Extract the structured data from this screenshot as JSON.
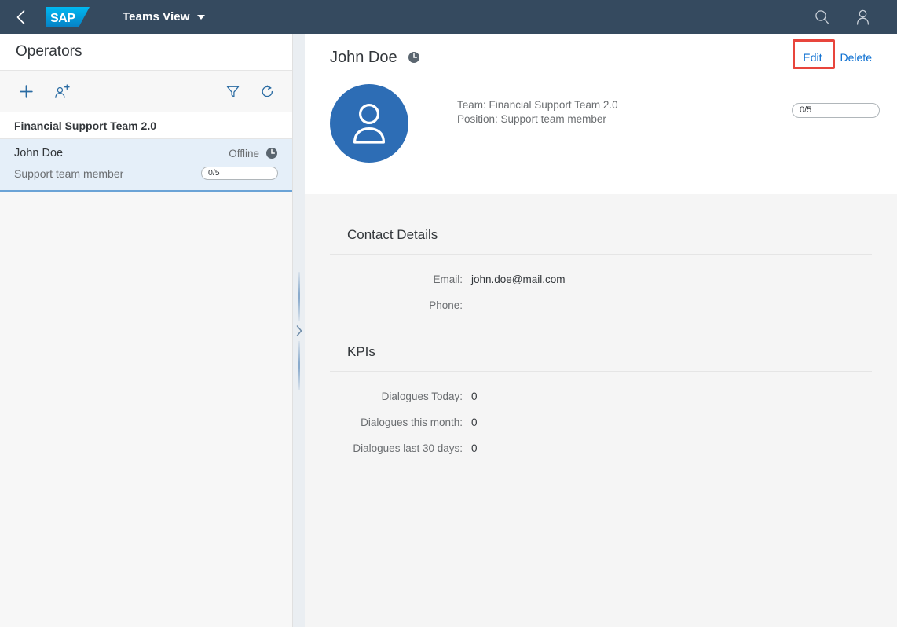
{
  "shell": {
    "back_icon": "chevron-left-icon",
    "logo_text": "SAP",
    "app_title": "Teams View",
    "dropdown_icon": "caret-down-icon",
    "search_icon": "search-icon",
    "user_icon": "user-icon",
    "header_bg": "#354a5f"
  },
  "master": {
    "title": "Operators",
    "toolbar": {
      "add_label": "add-icon",
      "add_person_label": "add-person-icon",
      "filter_label": "filter-icon",
      "refresh_label": "refresh-icon"
    },
    "group_header": "Financial Support Team 2.0",
    "items": [
      {
        "name": "John Doe",
        "status": "Offline",
        "status_icon": "clock-icon",
        "position": "Support team member",
        "progress_label": "0/5",
        "progress_percent": 0,
        "selected": true
      }
    ]
  },
  "splitter": {
    "collapse_icon": "chevron-right-icon"
  },
  "detail": {
    "title": "John Doe",
    "title_status_icon": "clock-icon",
    "actions": [
      {
        "label": "Edit",
        "highlighted": true
      },
      {
        "label": "Delete",
        "highlighted": false
      }
    ],
    "highlight_color": "#e8453c",
    "avatar_icon": "person-icon",
    "avatar_color": "#2d6db5",
    "hero": {
      "team_line": "Team: Financial Support Team 2.0",
      "position_line": "Position: Support team member",
      "progress_label": "0/5",
      "progress_percent": 0
    },
    "sections": [
      {
        "title": "Contact Details",
        "rows": [
          {
            "label": "Email:",
            "value": "john.doe@mail.com"
          },
          {
            "label": "Phone:",
            "value": ""
          }
        ]
      },
      {
        "title": "KPIs",
        "rows": [
          {
            "label": "Dialogues Today:",
            "value": "0"
          },
          {
            "label": "Dialogues this month:",
            "value": "0"
          },
          {
            "label": "Dialogues last 30 days:",
            "value": "0"
          }
        ]
      }
    ]
  },
  "colors": {
    "accent": "#0a6ed1",
    "header": "#354a5f",
    "selected_row": "#e5eff9",
    "selected_border": "#6ba3d6"
  }
}
